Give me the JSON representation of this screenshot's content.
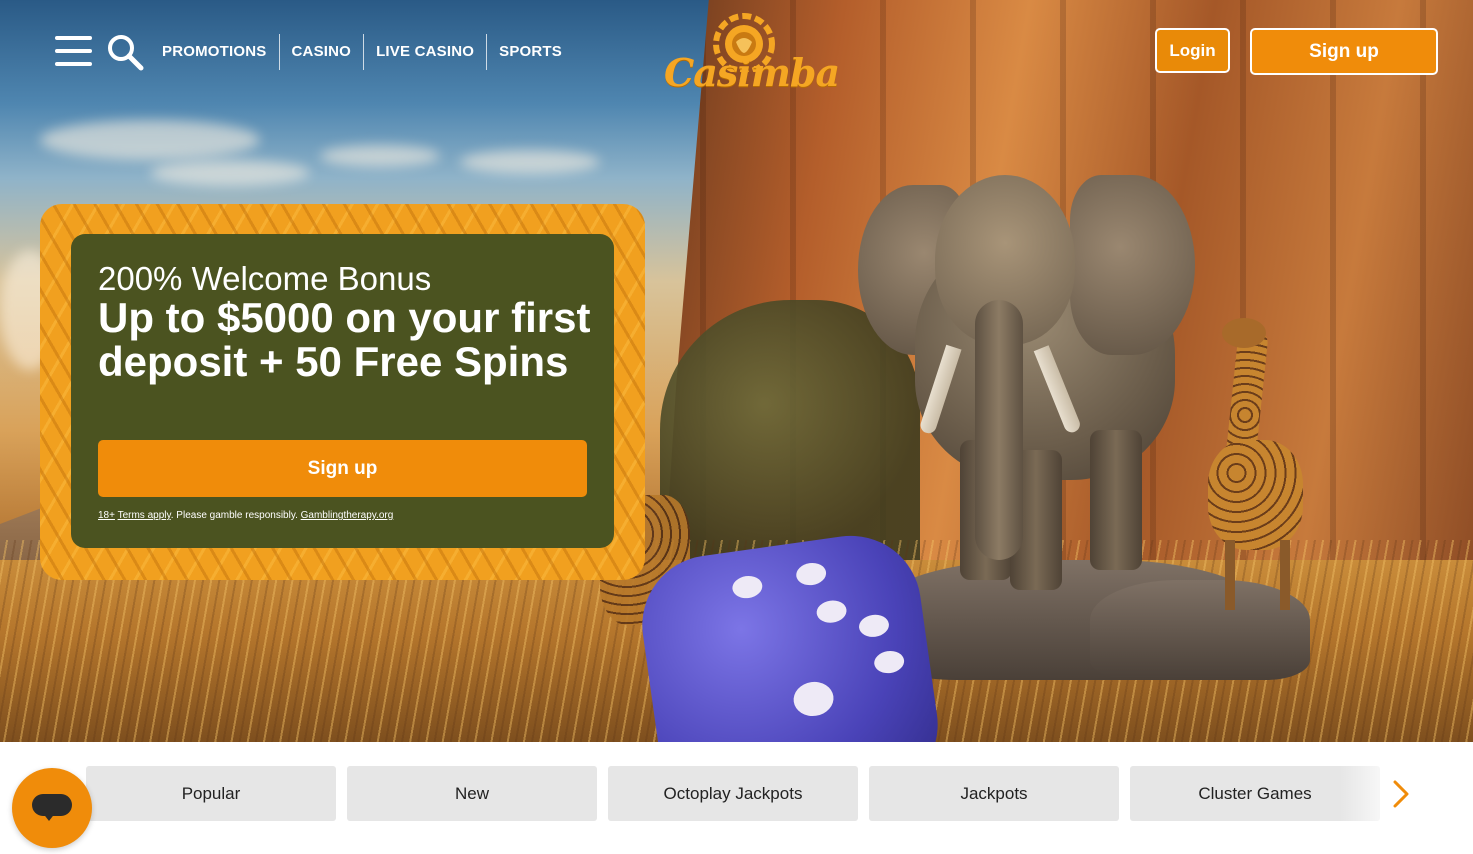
{
  "header": {
    "nav": [
      "PROMOTIONS",
      "CASINO",
      "LIVE CASINO",
      "SPORTS"
    ],
    "logo_text": "Casimba",
    "login_label": "Login",
    "signup_label": "Sign up",
    "icons": {
      "menu": "hamburger-menu-icon",
      "search": "search-icon"
    }
  },
  "promo": {
    "subtitle": "200% Welcome Bonus",
    "headline": "Up to $5000 on your first deposit + 50 Free Spins",
    "cta_label": "Sign up",
    "disclaimer": {
      "age": "18+",
      "terms": "Terms apply",
      "text": ". Please gamble responsibly. ",
      "link": "Gamblingtherapy.org"
    }
  },
  "categories": [
    "Popular",
    "New",
    "Octoplay Jackpots",
    "Jackpots",
    "Cluster Games"
  ],
  "colors": {
    "accent": "#f08c0a",
    "promo_panel": "#4b5320",
    "promo_frame": "#f1a01f",
    "tab_bg": "#e6e6e6"
  }
}
